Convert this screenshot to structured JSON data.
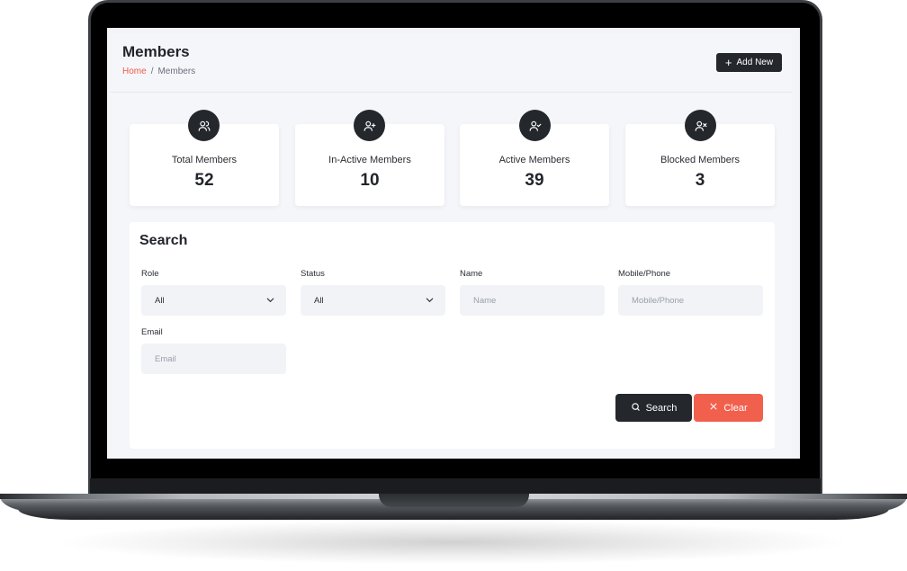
{
  "header": {
    "title": "Members",
    "breadcrumb": {
      "home": "Home",
      "separator": "/",
      "current": "Members"
    },
    "add_button": "Add New"
  },
  "stats": [
    {
      "label": "Total Members",
      "value": "52",
      "icon": "users-icon"
    },
    {
      "label": "In-Active Members",
      "value": "10",
      "icon": "user-plus-icon"
    },
    {
      "label": "Active Members",
      "value": "39",
      "icon": "user-check-icon"
    },
    {
      "label": "Blocked Members",
      "value": "3",
      "icon": "user-x-icon"
    }
  ],
  "search": {
    "title": "Search",
    "role": {
      "label": "Role",
      "value": "All"
    },
    "status": {
      "label": "Status",
      "value": "All"
    },
    "name": {
      "label": "Name",
      "placeholder": "Name"
    },
    "mobile": {
      "label": "Mobile/Phone",
      "placeholder": "Mobile/Phone"
    },
    "email": {
      "label": "Email",
      "placeholder": "Email"
    },
    "search_button": "Search",
    "clear_button": "Clear"
  },
  "colors": {
    "accent": "#ef5a47",
    "dark": "#24272c",
    "clear_button": "#f1604d",
    "background": "#f5f6fa"
  }
}
